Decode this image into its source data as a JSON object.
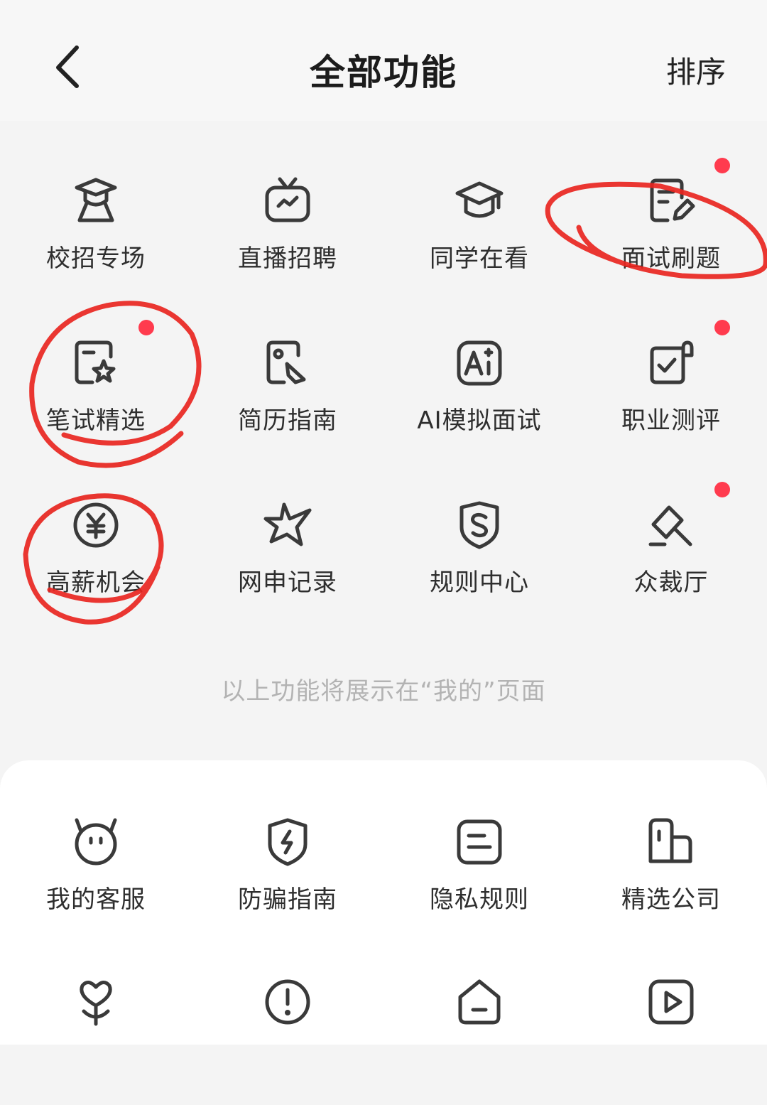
{
  "header": {
    "title": "全部功能",
    "sort_label": "排序"
  },
  "my_functions": [
    {
      "label": "校招专场",
      "icon": "graduate-icon"
    },
    {
      "label": "直播招聘",
      "icon": "tv-live-icon"
    },
    {
      "label": "同学在看",
      "icon": "graduation-cap-icon"
    },
    {
      "label": "面试刷题",
      "icon": "note-edit-icon",
      "badge": true
    },
    {
      "label": "笔试精选",
      "icon": "folder-star-icon",
      "badge": true
    },
    {
      "label": "简历指南",
      "icon": "document-pen-icon"
    },
    {
      "label": "AI模拟面试",
      "icon": "ai-icon"
    },
    {
      "label": "职业测评",
      "icon": "checklist-icon",
      "badge": true
    },
    {
      "label": "高薪机会",
      "icon": "yuan-coin-icon"
    },
    {
      "label": "网申记录",
      "icon": "star-icon"
    },
    {
      "label": "规则中心",
      "icon": "shield-s-icon"
    },
    {
      "label": "众裁厅",
      "icon": "gavel-icon",
      "badge": true
    }
  ],
  "hint": "以上功能将展示在“我的”页面",
  "more_functions": [
    {
      "label": "我的客服",
      "icon": "robot-face-icon"
    },
    {
      "label": "防骗指南",
      "icon": "shield-bolt-icon"
    },
    {
      "label": "隐私规则",
      "icon": "document-lines-icon"
    },
    {
      "label": "精选公司",
      "icon": "building-icon"
    },
    {
      "label": "",
      "icon": "heart-flower-icon"
    },
    {
      "label": "",
      "icon": "alert-circle-icon"
    },
    {
      "label": "",
      "icon": "home-icon"
    },
    {
      "label": "",
      "icon": "video-play-icon"
    }
  ],
  "colors": {
    "badge": "#ff3b4e",
    "annotation": "#e8251f",
    "icon_stroke": "#3a3a3a",
    "hint": "#b3b3b3"
  }
}
